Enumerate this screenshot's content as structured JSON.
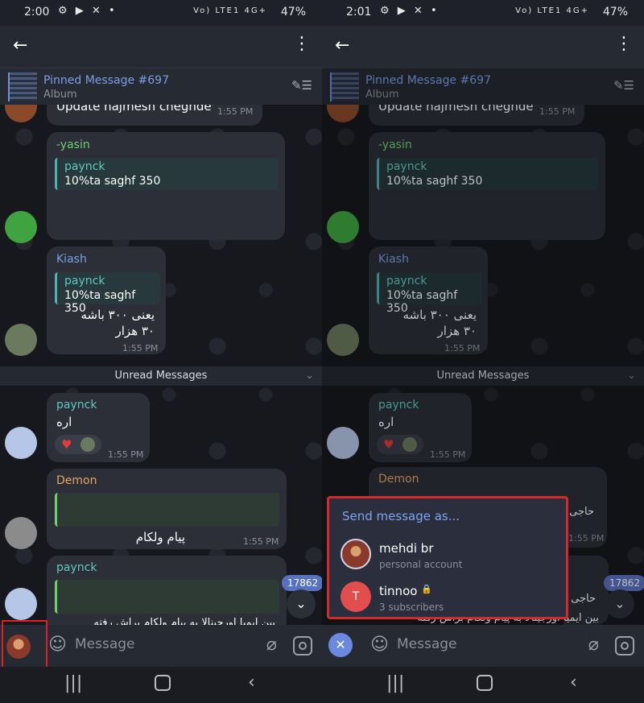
{
  "colors": {
    "accent": "#7a9fe6",
    "highlight": "#e02020",
    "badge": "#5872c2"
  },
  "left": {
    "status": {
      "time": "2:00",
      "battery": "47%",
      "network": "Vo) LTE1 4G+"
    },
    "pinned": {
      "title": "Pinned Message #697",
      "subtitle": "Album"
    },
    "messages": {
      "m1_text": "Update hajmesh cheghde'",
      "m1_time": "1:55 PM",
      "m2_sender": "-yasin",
      "m2_qname": "paynck",
      "m2_qtext": "10%ta saghf 350",
      "m3_sender": "Kiash",
      "m3_qname": "paynck",
      "m3_qtext": "10%ta saghf 350",
      "m3_line1": "یعنی ۳۰۰ باشه",
      "m3_line2": "۳۰ هزار",
      "m3_time": "1:55 PM",
      "unread": "Unread Messages",
      "m4_sender": "paynck",
      "m4_text": "اره",
      "m4_time": "1:55 PM",
      "m5_sender": "Demon",
      "m5_text": "پیام ولکام",
      "m5_time": "1:55 PM",
      "m6_sender": "paynck",
      "m6_text": "بین ایمیا اورجینالا به پیام ولکام براش رفته"
    },
    "badge": "17862",
    "input_placeholder": "Message"
  },
  "right": {
    "status": {
      "time": "2:01",
      "battery": "47%",
      "network": "Vo) LTE1 4G+"
    },
    "pinned": {
      "title": "Pinned Message #697",
      "subtitle": "Album"
    },
    "messages": {
      "m1_text": "Update hajmesh cheghde'",
      "m1_time": "1:55 PM",
      "m2_sender": "-yasin",
      "m2_qname": "paynck",
      "m2_qtext": "10%ta saghf 350",
      "m3_sender": "Kiash",
      "m3_qname": "paynck",
      "m3_qtext": "10%ta saghf 350",
      "m3_line1": "یعنی ۳۰۰ باشه",
      "m3_line2": "۳۰ هزار",
      "m3_time": "1:55 PM",
      "unread": "Unread Messages",
      "m4_sender": "paynck",
      "m4_text": "اره",
      "m4_time": "1:55 PM",
      "m5_sender": "Demon",
      "m5_text": "حاجی",
      "m5_time": "1:55 PM",
      "m6_text": "حاجی",
      "m7_text": "بین ایمیا اورجینالا به پیام ولکام براش رفته"
    },
    "badge": "17862",
    "input_placeholder": "Message",
    "send_as": {
      "title": "Send message as...",
      "accounts": [
        {
          "name": "mehdi br",
          "sub": "personal account"
        },
        {
          "name": "tinnoo",
          "sub": "3 subscribers",
          "initial": "T"
        }
      ]
    }
  }
}
